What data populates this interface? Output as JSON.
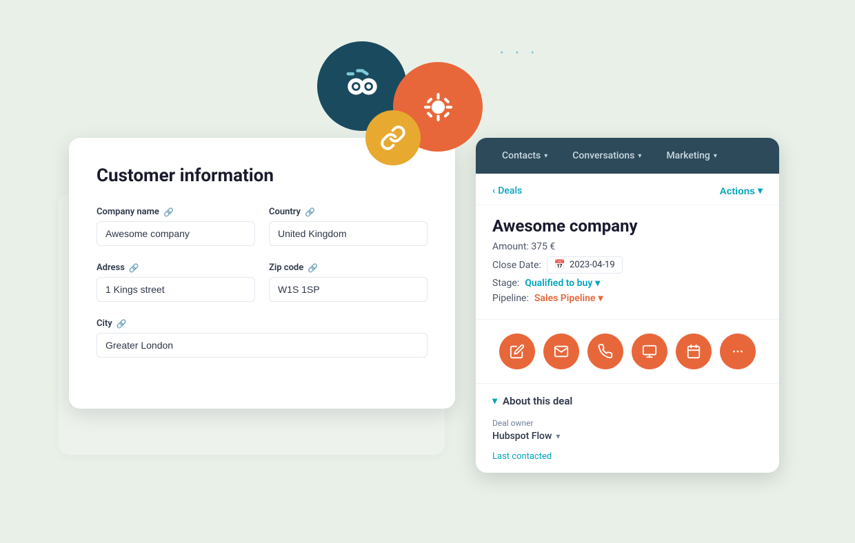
{
  "floating": {
    "dots": "· · ·"
  },
  "nav": {
    "contacts_label": "Contacts",
    "conversations_label": "Conversations",
    "marketing_label": "Marketing"
  },
  "deals": {
    "breadcrumb": "Deals",
    "actions_label": "Actions"
  },
  "deal": {
    "title": "Awesome company",
    "amount_label": "Amount:",
    "amount_value": "375 €",
    "close_date_label": "Close Date:",
    "close_date_value": "2023-04-19",
    "stage_label": "Stage:",
    "stage_value": "Qualified to buy",
    "pipeline_label": "Pipeline:",
    "pipeline_value": "Sales Pipeline"
  },
  "about_section": {
    "header": "About this deal",
    "owner_label": "Deal owner",
    "owner_value": "Hubspot Flow",
    "last_contacted": "Last contacted"
  },
  "customer_form": {
    "title": "Customer information",
    "company_name_label": "Company name",
    "company_name_value": "Awesome company",
    "country_label": "Country",
    "country_value": "United Kingdom",
    "address_label": "Adress",
    "address_value": "1 Kings street",
    "zip_code_label": "Zip code",
    "zip_code_value": "W1S 1SP",
    "city_label": "City",
    "city_value": "Greater London"
  }
}
